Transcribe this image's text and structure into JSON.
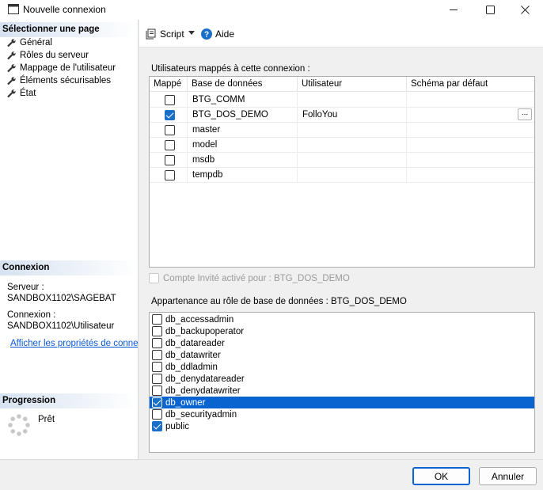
{
  "window": {
    "title": "Nouvelle connexion"
  },
  "left": {
    "select_page_header": "Sélectionner une page",
    "pages": [
      {
        "label": "Général"
      },
      {
        "label": "Rôles du serveur"
      },
      {
        "label": "Mappage de l'utilisateur"
      },
      {
        "label": "Éléments sécurisables"
      },
      {
        "label": "État"
      }
    ],
    "connection_header": "Connexion",
    "server_label": "Serveur :",
    "server_value": "SANDBOX1102\\SAGEBAT",
    "connection_label": "Connexion :",
    "connection_value": "SANDBOX1102\\Utilisateur",
    "properties_link": "Afficher les propriétés de connexion",
    "progress_header": "Progression",
    "progress_status": "Prêt"
  },
  "toolbar": {
    "script_label": "Script",
    "help_label": "Aide"
  },
  "mapping": {
    "label": "Utilisateurs mappés à cette connexion :",
    "columns": [
      "Mappé",
      "Base de données",
      "Utilisateur",
      "Schéma par défaut"
    ],
    "rows": [
      {
        "mapped": false,
        "database": "BTG_COMM",
        "user": "",
        "schema": ""
      },
      {
        "mapped": true,
        "database": "BTG_DOS_DEMO",
        "user": "FolloYou",
        "schema": "",
        "browse": "..."
      },
      {
        "mapped": false,
        "database": "master",
        "user": "",
        "schema": ""
      },
      {
        "mapped": false,
        "database": "model",
        "user": "",
        "schema": ""
      },
      {
        "mapped": false,
        "database": "msdb",
        "user": "",
        "schema": ""
      },
      {
        "mapped": false,
        "database": "tempdb",
        "user": "",
        "schema": ""
      }
    ]
  },
  "guest": {
    "label": "Compte Invité activé pour : BTG_DOS_DEMO",
    "checked": false,
    "enabled": false
  },
  "roles": {
    "label": "Appartenance au rôle de base de données : BTG_DOS_DEMO",
    "items": [
      {
        "name": "db_accessadmin",
        "checked": false
      },
      {
        "name": "db_backupoperator",
        "checked": false
      },
      {
        "name": "db_datareader",
        "checked": false
      },
      {
        "name": "db_datawriter",
        "checked": false
      },
      {
        "name": "db_ddladmin",
        "checked": false
      },
      {
        "name": "db_denydatareader",
        "checked": false
      },
      {
        "name": "db_denydatawriter",
        "checked": false
      },
      {
        "name": "db_owner",
        "checked": true,
        "selected": true
      },
      {
        "name": "db_securityadmin",
        "checked": false
      },
      {
        "name": "public",
        "checked": true
      }
    ]
  },
  "footer": {
    "ok_label": "OK",
    "cancel_label": "Annuler"
  },
  "colors": {
    "accent": "#0a64d0",
    "link": "#0b59d6",
    "header_gradient": "#d6e2f1"
  }
}
